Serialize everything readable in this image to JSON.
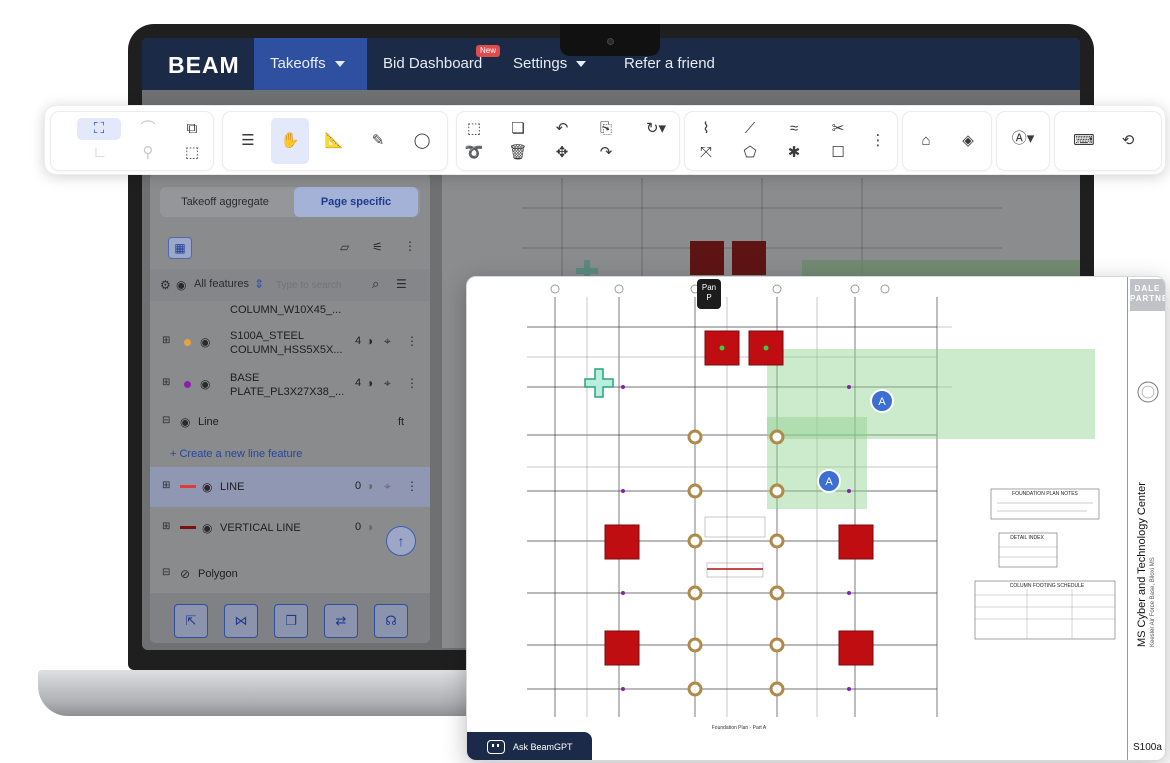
{
  "app": {
    "logo": "BEAM",
    "nav": [
      {
        "label": "Takeoffs"
      },
      {
        "label": "Bid Dashboard",
        "badge": "New"
      },
      {
        "label": "Settings"
      },
      {
        "label": "Refer a friend"
      }
    ]
  },
  "sidebar": {
    "tabs": [
      "Takeoff aggregate",
      "Page specific"
    ],
    "active_tab": "Page specific",
    "filter_label": "All features",
    "search_placeholder": "Type to search",
    "rows": [
      {
        "label": "COLUMN_W10X45_...",
        "color": "#e8a33d"
      },
      {
        "label": "S100A_STEEL COLUMN_HSS5X5X...",
        "count": "4",
        "color": "#e8a33d"
      },
      {
        "label": "BASE PLATE_PL3X27X38_...",
        "count": "4",
        "color": "#8a1fae"
      }
    ],
    "line_group": {
      "label": "Line",
      "unit": "ft"
    },
    "create_line_label": "+ Create a new line feature",
    "line_rows": [
      {
        "label": "LINE",
        "count": "0",
        "color": "#e03b3b"
      },
      {
        "label": "VERTICAL LINE",
        "count": "0",
        "color": "#7a1010"
      }
    ],
    "polygon_group": {
      "label": "Polygon"
    }
  },
  "panel": {
    "pan_tooltip": "Pan",
    "pan_shortcut": "P",
    "company_logo": "DALE PARTNERS",
    "project_title": "MS Cyber and Technology Center",
    "project_subtitle": "Keesler Air Force Base, Biloxi MS",
    "sheet_number": "S100a",
    "ask_button": "Ask BeamGPT",
    "sheet_caption": "Foundation Plan - Part A",
    "notes_title": "FOUNDATION PLAN NOTES",
    "detail_index_title": "DETAIL INDEX",
    "schedule_title": "COLUMN FOOTING SCHEDULE",
    "marker_label": "A"
  }
}
